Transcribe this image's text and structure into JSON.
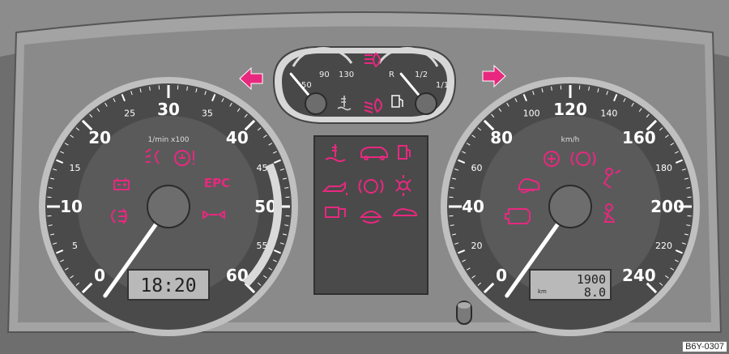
{
  "tachometer": {
    "unit_label": "1/min x100",
    "major_labels": [
      "0",
      "10",
      "20",
      "30",
      "40",
      "50",
      "60"
    ],
    "minor_labels": [
      "5",
      "15",
      "25",
      "35",
      "45",
      "55"
    ],
    "redline_from": 45,
    "needle_value": 0,
    "clock": "18:20"
  },
  "speedometer": {
    "unit_label": "km/h",
    "major_labels": [
      "0",
      "40",
      "80",
      "120",
      "160",
      "200",
      "240"
    ],
    "minor_labels": [
      "20",
      "60",
      "100",
      "140",
      "180",
      "220"
    ],
    "needle_value": 0,
    "odometer": "1900",
    "trip": "8.0",
    "trip_unit": "km"
  },
  "temp_gauge": {
    "labels": [
      "50",
      "90",
      "130"
    ],
    "needle_fraction": 0.0
  },
  "fuel_gauge": {
    "labels": [
      "R",
      "1/2",
      "1/1"
    ],
    "needle_fraction": 0.0
  },
  "center_panel_icons": [
    "coolant-temp-icon",
    "door-open-icon",
    "fuel-reserve-icon",
    "oil-pressure-icon",
    "brake-pads-icon",
    "bulb-failure-icon",
    "boot-lid-open-icon",
    "washer-fluid-icon",
    "convertible-open-icon"
  ],
  "tacho_icons": [
    "rear-fog-icon",
    "brake-system-icon",
    "battery-icon",
    "epc-icon",
    "front-fog-icon",
    "turn-signal-trailer-icon"
  ],
  "speedo_icons": [
    "abs-icon",
    "brake-warning-icon",
    "esp-icon",
    "airbag-icon",
    "engine-check-icon",
    "seatbelt-icon"
  ],
  "epc_text": "EPC",
  "arrows": {
    "left": "turn-left-arrow",
    "right": "turn-right-arrow"
  },
  "colors": {
    "warning": "#e8287f",
    "dial_face": "#4a4a4a",
    "panel": "#9b9b9b",
    "needle": "#ffffff"
  },
  "reference_code": "B6Y-0307"
}
